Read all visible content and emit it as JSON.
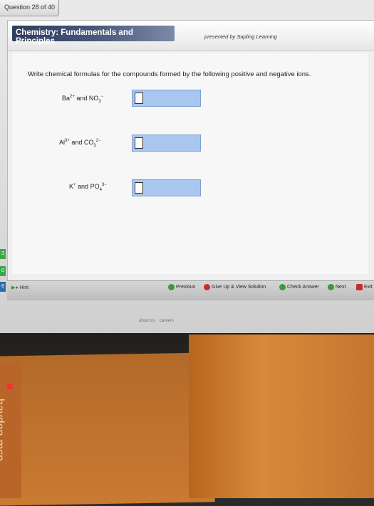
{
  "question_tab": "Question 28 of 40",
  "banner_title": "Chemistry: Fundamentals and Principles",
  "presented_by": "presented by Sapling Learning",
  "instructions": "Write chemical formulas for the compounds formed by the following positive and negative ions.",
  "questions": [
    {
      "cation": "Ba",
      "cation_charge": "2+",
      "and": "and",
      "anion": "NO",
      "anion_sub": "3",
      "anion_charge": "−"
    },
    {
      "cation": "Al",
      "cation_charge": "3+",
      "and": "and",
      "anion": "CO",
      "anion_sub": "3",
      "anion_charge": "2−"
    },
    {
      "cation": "K",
      "cation_charge": "+",
      "and": "and",
      "anion": "PO",
      "anion_sub": "4",
      "anion_charge": "3−"
    }
  ],
  "toolbar": {
    "hint": "Hint",
    "previous": "Previous",
    "give_up": "Give Up & View Solution",
    "check_answer": "Check Answer",
    "next": "Next",
    "exit": "Exit"
  },
  "footer_links": [
    "about us",
    "careers"
  ],
  "book_text": "hayden-mcn",
  "colors": {
    "banner": "#3a4868",
    "answer_box": "#a9c6ee",
    "green": "#3a9a3a",
    "red": "#c62b2b"
  }
}
